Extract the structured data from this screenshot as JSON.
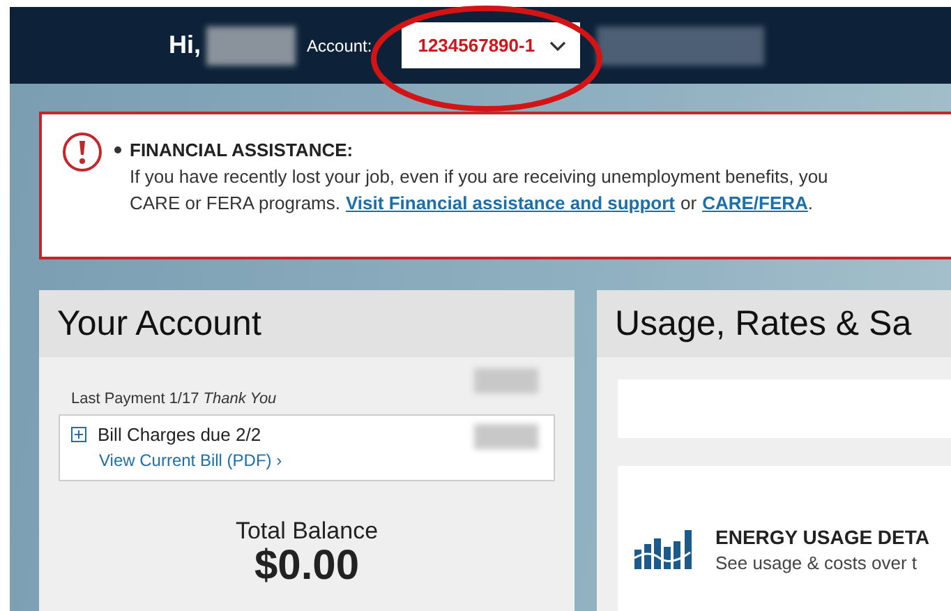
{
  "header": {
    "greeting": "Hi,",
    "account_label": "Account:",
    "account_number": "1234567890-1"
  },
  "alert": {
    "title": "FINANCIAL ASSISTANCE:",
    "line_1": "If you have recently lost your job, even if you are receiving unemployment benefits, you",
    "line_2": "CARE or FERA programs.",
    "link_1": "Visit Financial assistance and support",
    "joiner": "or",
    "link_2": "CARE/FERA",
    "end": "."
  },
  "account_panel": {
    "title": "Your Account",
    "last_payment": "Last Payment 1/17",
    "thanks": "Thank You",
    "bill_charges": "Bill Charges due 2/2",
    "bill_link": "View Current Bill (PDF)",
    "bill_link_arrow": "›",
    "total_label": "Total Balance",
    "total_value": "$0.00"
  },
  "usage_panel": {
    "title": "Usage, Rates & Sa",
    "tile_title": "ENERGY USAGE DETA",
    "tile_text": "See usage & costs over t"
  }
}
